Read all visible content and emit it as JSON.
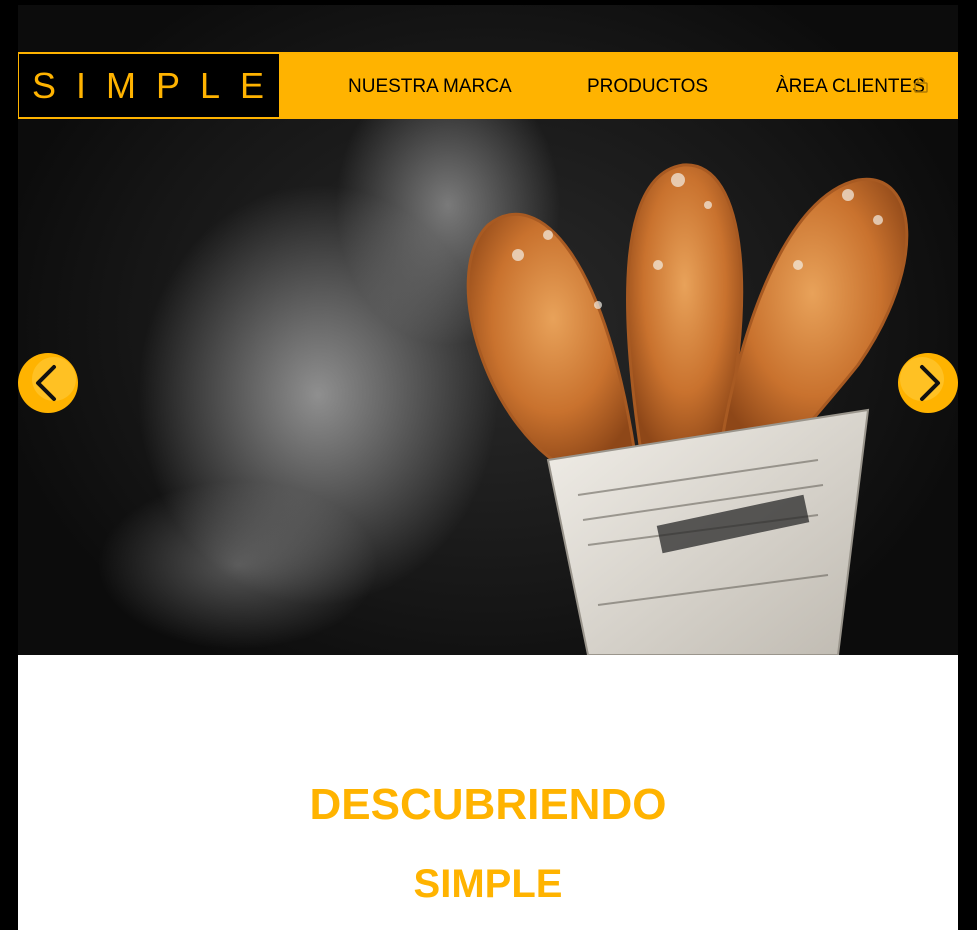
{
  "logo": {
    "text": "SIMPLE"
  },
  "nav": {
    "items": [
      {
        "label": "NUESTRA MARCA"
      },
      {
        "label": "PRODUCTOS"
      },
      {
        "label": "ÀREA CLIENTES"
      }
    ]
  },
  "hero": {
    "image": "churros-with-powdered-sugar-in-newspaper-cone",
    "prev_icon": "chevron-left-icon",
    "next_icon": "chevron-right-icon"
  },
  "section": {
    "title": "DESCUBRIENDO",
    "subtitle": "SIMPLE"
  },
  "colors": {
    "accent": "#ffb300",
    "background": "#000000",
    "content": "#ffffff"
  }
}
